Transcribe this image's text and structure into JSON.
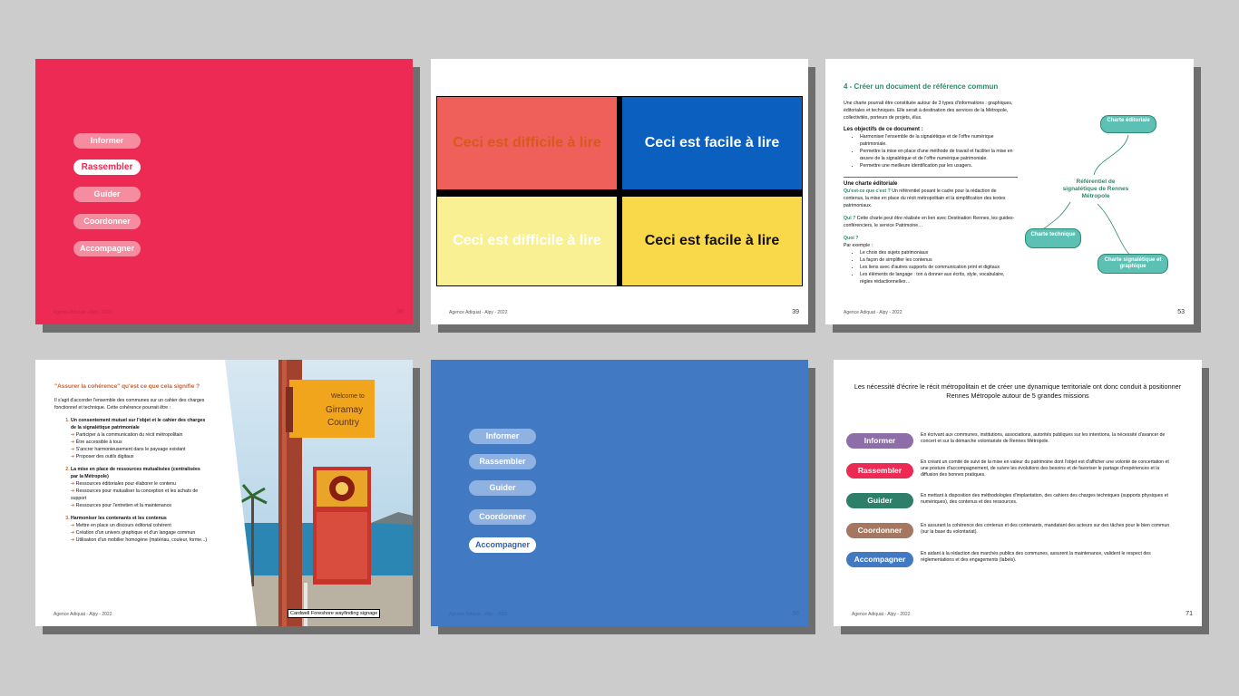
{
  "slide1": {
    "pills": [
      "Informer",
      "Rassembler",
      "Guider",
      "Coordonner",
      "Accompagner"
    ],
    "active": "Rassembler",
    "footer": "Agence Adiquat - Alpy - 2022",
    "page": "36",
    "color": "#ec2a53"
  },
  "slide2": {
    "q1": "Ceci est difficile à lire",
    "q2": "Ceci est facile à lire",
    "q3": "Ceci est difficile à lire",
    "q4": "Ceci est facile à lire",
    "footer": "Agence Adiquat - Alpy - 2022",
    "page": "39"
  },
  "slide3": {
    "title": "4 - Créer un document de référence commun",
    "intro": "Une charte pourrait être constituée autour de 3 types d'informations : graphiques, éditoriales et techniques. Elle serait à destination des services de la Métropole, collectivités, porteurs de projets, élus.",
    "objectives_heading": "Les objectifs de ce document :",
    "objectives": [
      "Harmoniser l'ensemble de la signalétique et de l'offre numérique patrimoniale.",
      "Permettre la mise en place d'une méthode de travail et faciliter la mise en œuvre de la signalétique et de l'offre numérique patrimoniale.",
      "Permettre une meilleure identification par les usagers."
    ],
    "editorial_heading": "Une charte éditoriale",
    "q_what": "Qu'est-ce que c'est ?",
    "a_what": "Un référentiel posant le cadre pour la rédaction de contenus, la mise en place du récit métropolitain et la simplification des textes patrimoniaux.",
    "q_who": "Qui ?",
    "a_who": "Cette charte peut être réalisée en lien avec Destination Rennes, les guides-conférenciers, le service Patrimoine…",
    "q_quoi": "Quoi ?",
    "example_label": "Par exemple :",
    "examples": [
      "Le choix des sujets patrimoniaux",
      "La façon de simplifier les contenus",
      "Les liens avec d'autres supports de communication print et digitaux",
      "Les éléments de langage : ton à donner aux écrits, style, vocabulaire, règles rédactionnelles…"
    ],
    "node_editorial": "Charte éditoriale",
    "node_center": "Référentiel de signalétique de Rennes Métropole",
    "node_technique": "Charte technique",
    "node_graphique": "Charte signalétique et graphique",
    "footer": "Agence Adiquat - Alpy - 2022",
    "page": "53"
  },
  "slide4": {
    "title": "\"Assurer la cohérence\" qu'est ce que cela signifie ?",
    "intro": "Il s'agit d'accorder l'ensemble des communes sur un cahier des charges fonctionnel et technique. Cette cohérence pourrait être :",
    "items": [
      {
        "heading": "Un consentement mutuel sur l'objet et le cahier des charges de la signalétique patrimoniale",
        "subs": [
          "Participer à la communication du récit métropolitain",
          "Être accessible à tous",
          "S'ancrer harmonieusement dans le paysage existant",
          "Proposer des outils digitaux"
        ]
      },
      {
        "heading": "La mise en place de ressources mutualisées (centralisées par la Métropole)",
        "subs": [
          "Ressources éditoriales pour élaborer le contenu",
          "Ressources pour mutualiser la conception et les achats de support",
          "Ressources pour l'entretien et la maintenance"
        ]
      },
      {
        "heading": "Harmoniser les contenants et les contenus",
        "subs": [
          "Mettre en place un discours éditorial cohérent",
          "Création d'un univers graphique et d'un langage commun",
          "Utilisation d'un mobilier homogène (matériau, couleur, forme...)"
        ]
      }
    ],
    "photo_sign_line1": "Welcome to",
    "photo_sign_line2": "Girramay",
    "photo_sign_line3": "Country",
    "caption": "Cardwell Foreshore wayfinding signage",
    "footer": "Agence Adiquat - Alpy - 2022"
  },
  "slide5": {
    "pills": [
      "Informer",
      "Rassembler",
      "Guider",
      "Coordonner",
      "Accompagner"
    ],
    "active": "Accompagner",
    "footer": "Agence Adiquat - Alpy - 2022",
    "page": "66",
    "color": "#4179c2"
  },
  "slide6": {
    "title": "Les nécessité d'écrire le récit métropolitain et de créer une dynamique territoriale ont donc conduit à positionner Rennes Métropole autour de 5 grandes missions",
    "missions": [
      {
        "label": "Informer",
        "color": "#8e6ea8",
        "desc": "En écrivant aux communes, institutions, associations, autorités publiques sur les intentions, la nécessité d'avancer de concert et sur la démarche volontariste de Rennes Métropole."
      },
      {
        "label": "Rassembler",
        "color": "#ec2a53",
        "desc": "En créant un comité de suivi de la mise en valeur du patrimoine dont l'objet est d'afficher une volonté de concertation et une posture d'accompagnement, de suivre les évolutions des besoins et de favoriser le partage d'expériences et la diffusion des bonnes pratiques."
      },
      {
        "label": "Guider",
        "color": "#2e7f6a",
        "desc": "En mettant à disposition des méthodologies d'implantation, des cahiers des charges techniques (supports physiques et numériques), des contenus et des ressources."
      },
      {
        "label": "Coordonner",
        "color": "#a67760",
        "desc": "En assurant la cohérence des contenus et des contenants, mandatant des acteurs sur des tâches pour le bien commun (sur la base du volontariat)."
      },
      {
        "label": "Accompagner",
        "color": "#4179c2",
        "desc": "En aidant à la rédaction des marchés publics des communes, assurent la maintenance, valident le respect des réglementations et des engagements (labels)."
      }
    ],
    "footer": "Agence Adiquat - Alpy - 2022",
    "page": "71"
  }
}
